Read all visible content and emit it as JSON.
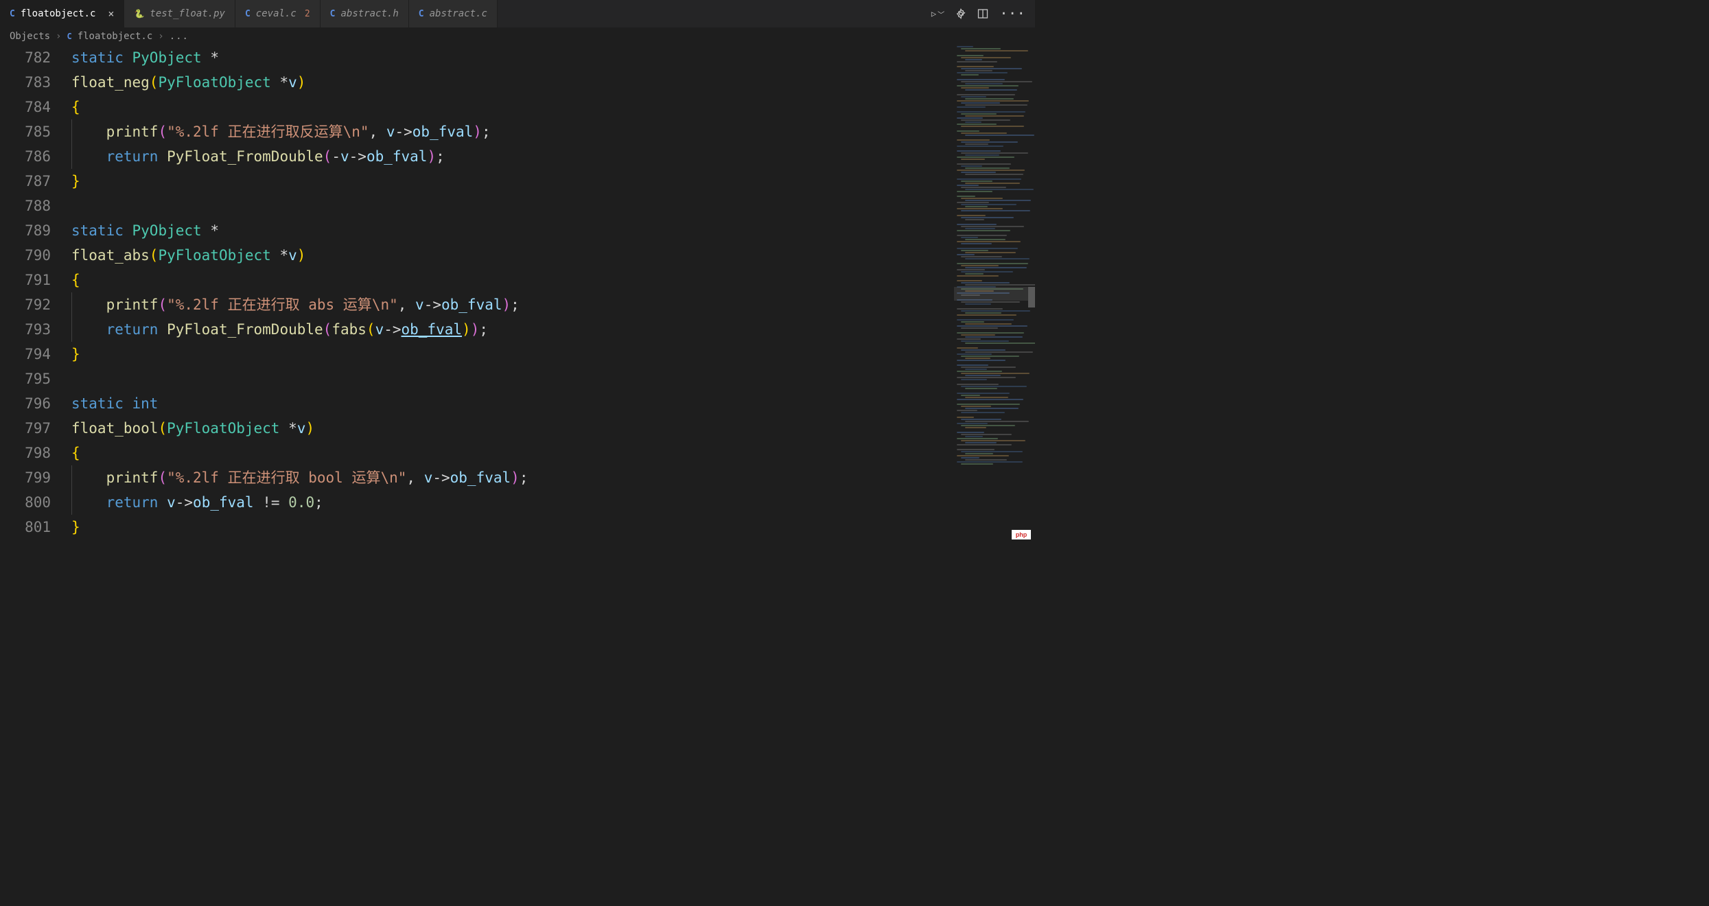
{
  "tabs": [
    {
      "lang": "C",
      "label": "floatobject.c",
      "active": true,
      "closable": true
    },
    {
      "lang": "py",
      "label": "test_float.py",
      "active": false,
      "closable": false
    },
    {
      "lang": "C",
      "label": "ceval.c",
      "active": false,
      "closable": false,
      "problems": "2"
    },
    {
      "lang": "C",
      "label": "abstract.h",
      "active": false,
      "closable": false
    },
    {
      "lang": "C",
      "label": "abstract.c",
      "active": false,
      "closable": false
    }
  ],
  "breadcrumb": {
    "folder": "Objects",
    "lang": "C",
    "file": "floatobject.c",
    "more": "..."
  },
  "code": {
    "first_line": 782,
    "lines": [
      {
        "n": "782",
        "t": [
          [
            "kw",
            "static"
          ],
          [
            "sp",
            " "
          ],
          [
            "type",
            "PyObject"
          ],
          [
            "sp",
            " "
          ],
          [
            "op",
            "*"
          ]
        ]
      },
      {
        "n": "783",
        "t": [
          [
            "func",
            "float_neg"
          ],
          [
            "brace",
            "("
          ],
          [
            "type",
            "PyFloatObject"
          ],
          [
            "sp",
            " "
          ],
          [
            "op",
            "*"
          ],
          [
            "param",
            "v"
          ],
          [
            "brace",
            ")"
          ]
        ]
      },
      {
        "n": "784",
        "t": [
          [
            "brace",
            "{"
          ]
        ]
      },
      {
        "n": "785",
        "indent": 1,
        "t": [
          [
            "func",
            "printf"
          ],
          [
            "brace2",
            "("
          ],
          [
            "str",
            "\"%.2lf 正在进行取反运算\\n\""
          ],
          [
            "op",
            ", "
          ],
          [
            "param",
            "v"
          ],
          [
            "op",
            "->"
          ],
          [
            "field",
            "ob_fval"
          ],
          [
            "brace2",
            ")"
          ],
          [
            "op",
            ";"
          ]
        ]
      },
      {
        "n": "786",
        "indent": 1,
        "t": [
          [
            "kw",
            "return"
          ],
          [
            "sp",
            " "
          ],
          [
            "func",
            "PyFloat_FromDouble"
          ],
          [
            "brace2",
            "("
          ],
          [
            "op",
            "-"
          ],
          [
            "param",
            "v"
          ],
          [
            "op",
            "->"
          ],
          [
            "field",
            "ob_fval"
          ],
          [
            "brace2",
            ")"
          ],
          [
            "op",
            ";"
          ]
        ]
      },
      {
        "n": "787",
        "t": [
          [
            "brace",
            "}"
          ]
        ]
      },
      {
        "n": "788",
        "t": []
      },
      {
        "n": "789",
        "t": [
          [
            "kw",
            "static"
          ],
          [
            "sp",
            " "
          ],
          [
            "type",
            "PyObject"
          ],
          [
            "sp",
            " "
          ],
          [
            "op",
            "*"
          ]
        ]
      },
      {
        "n": "790",
        "t": [
          [
            "func",
            "float_abs"
          ],
          [
            "brace",
            "("
          ],
          [
            "type",
            "PyFloatObject"
          ],
          [
            "sp",
            " "
          ],
          [
            "op",
            "*"
          ],
          [
            "param",
            "v"
          ],
          [
            "brace",
            ")"
          ]
        ]
      },
      {
        "n": "791",
        "t": [
          [
            "brace",
            "{"
          ]
        ]
      },
      {
        "n": "792",
        "indent": 1,
        "t": [
          [
            "func",
            "printf"
          ],
          [
            "brace2",
            "("
          ],
          [
            "str",
            "\"%.2lf 正在进行取 abs 运算\\n\""
          ],
          [
            "op",
            ", "
          ],
          [
            "param",
            "v"
          ],
          [
            "op",
            "->"
          ],
          [
            "field",
            "ob_fval"
          ],
          [
            "brace2",
            ")"
          ],
          [
            "op",
            ";"
          ]
        ]
      },
      {
        "n": "793",
        "indent": 1,
        "t": [
          [
            "kw",
            "return"
          ],
          [
            "sp",
            " "
          ],
          [
            "func",
            "PyFloat_FromDouble"
          ],
          [
            "brace2",
            "("
          ],
          [
            "func",
            "fabs"
          ],
          [
            "brace",
            "("
          ],
          [
            "param",
            "v"
          ],
          [
            "op",
            "->"
          ],
          [
            "link",
            "ob_fval"
          ],
          [
            "brace",
            ")"
          ],
          [
            "brace2",
            ")"
          ],
          [
            "op",
            ";"
          ]
        ]
      },
      {
        "n": "794",
        "t": [
          [
            "brace",
            "}"
          ]
        ]
      },
      {
        "n": "795",
        "t": []
      },
      {
        "n": "796",
        "t": [
          [
            "kw",
            "static"
          ],
          [
            "sp",
            " "
          ],
          [
            "int",
            "int"
          ]
        ]
      },
      {
        "n": "797",
        "t": [
          [
            "func",
            "float_bool"
          ],
          [
            "brace",
            "("
          ],
          [
            "type",
            "PyFloatObject"
          ],
          [
            "sp",
            " "
          ],
          [
            "op",
            "*"
          ],
          [
            "param",
            "v"
          ],
          [
            "brace",
            ")"
          ]
        ]
      },
      {
        "n": "798",
        "t": [
          [
            "brace",
            "{"
          ]
        ]
      },
      {
        "n": "799",
        "indent": 1,
        "t": [
          [
            "func",
            "printf"
          ],
          [
            "brace2",
            "("
          ],
          [
            "str",
            "\"%.2lf 正在进行取 bool 运算\\n\""
          ],
          [
            "op",
            ", "
          ],
          [
            "param",
            "v"
          ],
          [
            "op",
            "->"
          ],
          [
            "field",
            "ob_fval"
          ],
          [
            "brace2",
            ")"
          ],
          [
            "op",
            ";"
          ]
        ]
      },
      {
        "n": "800",
        "indent": 1,
        "t": [
          [
            "kw",
            "return"
          ],
          [
            "sp",
            " "
          ],
          [
            "param",
            "v"
          ],
          [
            "op",
            "->"
          ],
          [
            "field",
            "ob_fval"
          ],
          [
            "sp",
            " "
          ],
          [
            "op",
            "!="
          ],
          [
            "sp",
            " "
          ],
          [
            "num",
            "0.0"
          ],
          [
            "op",
            ";"
          ]
        ]
      },
      {
        "n": "801",
        "t": [
          [
            "brace",
            "}"
          ]
        ]
      }
    ]
  },
  "watermark": "php"
}
